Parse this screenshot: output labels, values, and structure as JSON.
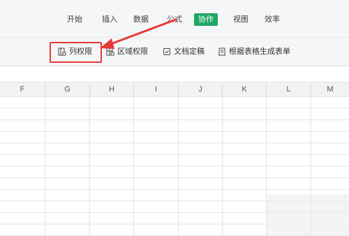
{
  "menu": {
    "tabs": [
      {
        "label": "开始"
      },
      {
        "label": "插入"
      },
      {
        "label": "数据"
      },
      {
        "label": "公式"
      },
      {
        "label": "协作",
        "active": true
      },
      {
        "label": "视图"
      },
      {
        "label": "效率"
      }
    ],
    "active_color": "#1fa665"
  },
  "toolbar": {
    "column_permission": "列权限",
    "region_permission": "区域权限",
    "doc_finalize": "文档定稿",
    "generate_form": "根据表格生成表单"
  },
  "annotation": {
    "highlight_color": "#e53935"
  },
  "sheet": {
    "columns": [
      "F",
      "G",
      "H",
      "I",
      "J",
      "K",
      "L",
      "M"
    ]
  }
}
